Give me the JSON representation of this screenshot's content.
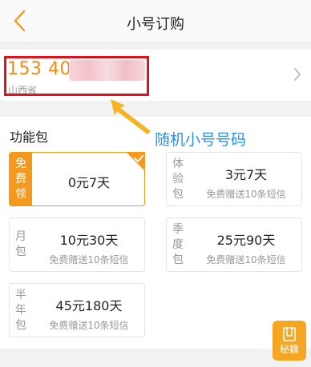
{
  "header": {
    "title": "小号订购"
  },
  "number": {
    "value": "153 40",
    "province": "山西省"
  },
  "annotation": {
    "text": "随机小号号码"
  },
  "section": {
    "title": "功能包"
  },
  "packages": [
    {
      "side": [
        "免",
        "费",
        "领"
      ],
      "price": "0元7天",
      "sub": ""
    },
    {
      "side": [
        "体",
        "验",
        "包"
      ],
      "price": "3元7天",
      "sub": "免费赠送10条短信"
    },
    {
      "side": [
        "月",
        "包"
      ],
      "price": "10元30天",
      "sub": "免费赠送10条短信"
    },
    {
      "side": [
        "季",
        "度",
        "包"
      ],
      "price": "25元90天",
      "sub": "免费赠送10条短信"
    },
    {
      "side": [
        "半",
        "年",
        "包"
      ],
      "price": "45元180天",
      "sub": "免费赠送10条短信"
    }
  ],
  "float_button": {
    "label": "秘籍"
  },
  "colors": {
    "accent": "#f39a1e",
    "number": "#f08c12",
    "highlight": "#e0121a",
    "annotation": "#2a8fe8"
  }
}
